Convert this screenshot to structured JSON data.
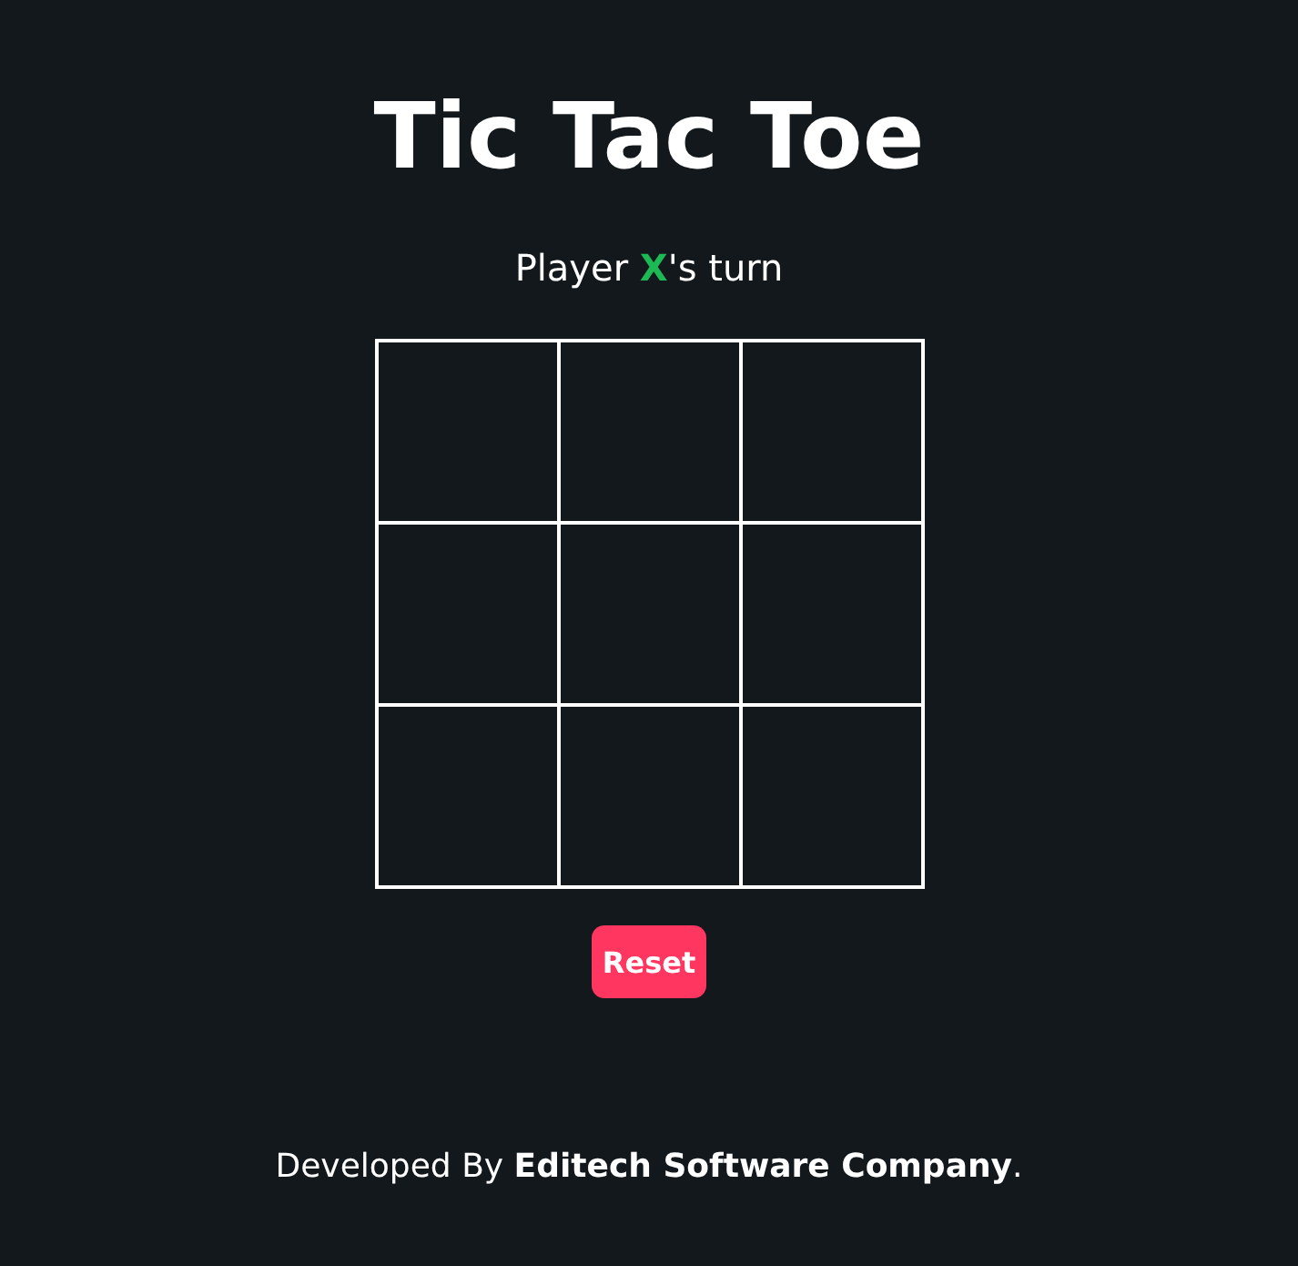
{
  "title": "Tic Tac Toe",
  "status": "Player **X**'s turn",
  "board": {
    "cells": [
      {
        "kind": "empty"
      },
      {
        "kind": "empty"
      },
      {
        "kind": "empty"
      },
      {
        "kind": "empty"
      },
      {
        "kind": "empty"
      },
      {
        "kind": "empty"
      },
      {
        "kind": "empty"
      },
      {
        "kind": "empty"
      },
      {
        "kind": "empty"
      }
    ]
  },
  "reset_button": "Reset",
  "footer": "Developed By **Editech Software Company**."
}
